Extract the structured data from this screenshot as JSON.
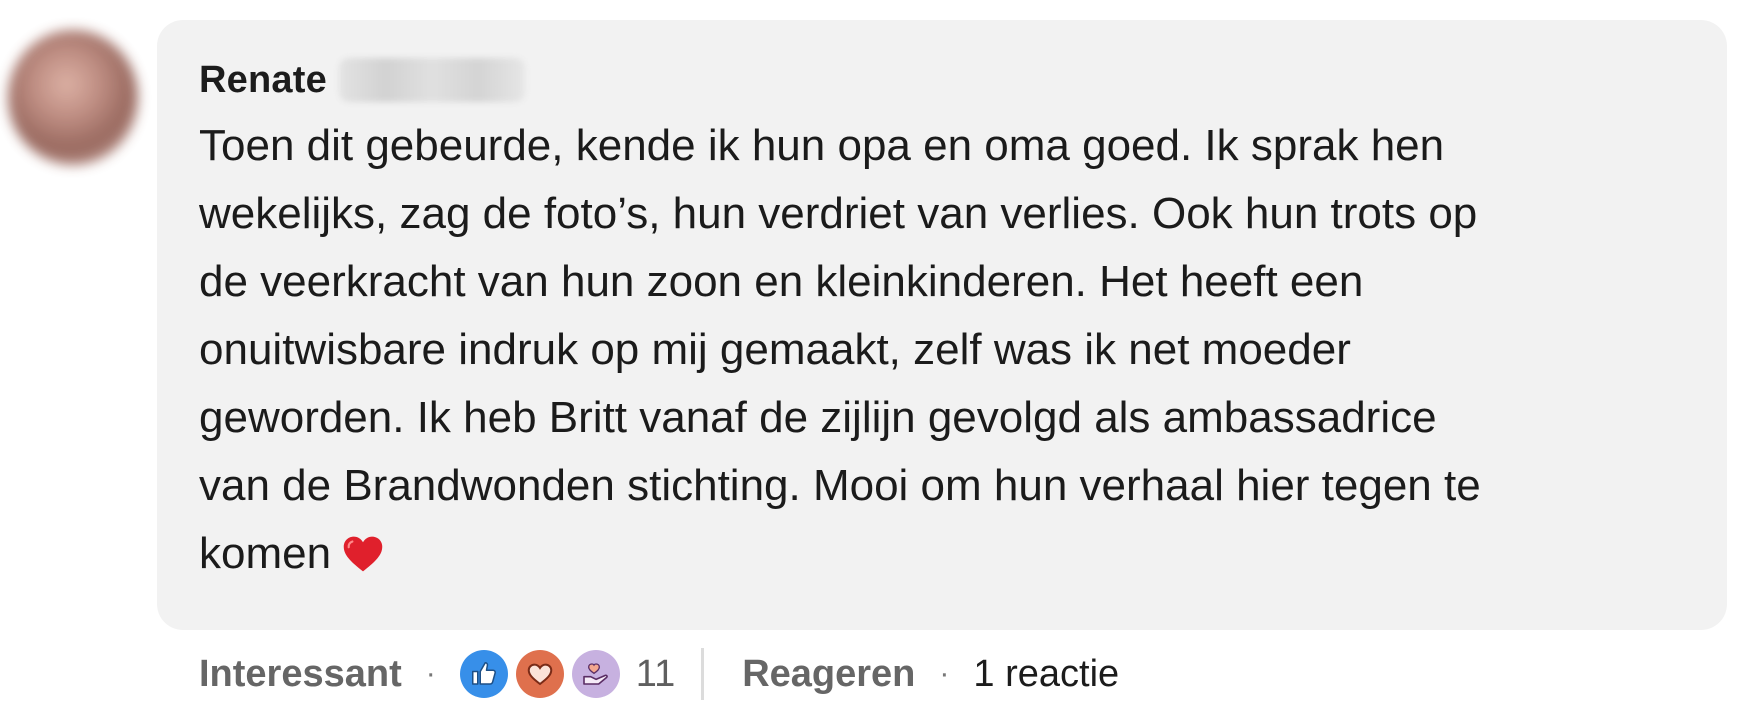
{
  "comment": {
    "author_first": "Renate",
    "text": "Toen dit gebeurde, kende ik hun opa en oma goed. Ik sprak hen\nwekelijks, zag de foto’s, hun verdriet van verlies. Ook hun trots op\nde veerkracht van hun zoon en kleinkinderen. Het heeft een\nonuitwisbare indruk op mij gemaakt, zelf was ik net moeder\ngeworden. Ik heb Britt vanaf de zijlijn gevolgd als ambassadrice\nvan de Brandwonden stichting. Mooi om hun verhaal hier tegen te\nkomen",
    "trailing_emoji": "red-heart-icon"
  },
  "actions": {
    "react_label": "Interessant",
    "separator": "·",
    "reaction_icons": [
      "like-icon",
      "love-icon",
      "support-icon"
    ],
    "reaction_count": "11",
    "reply_label": "Reageren",
    "replies_label": "1 reactie"
  },
  "colors": {
    "bubble_bg": "#f2f2f2",
    "like": "#378fe9",
    "love": "#df704d",
    "support": "#c7b1e0",
    "heart": "#e0202c"
  }
}
